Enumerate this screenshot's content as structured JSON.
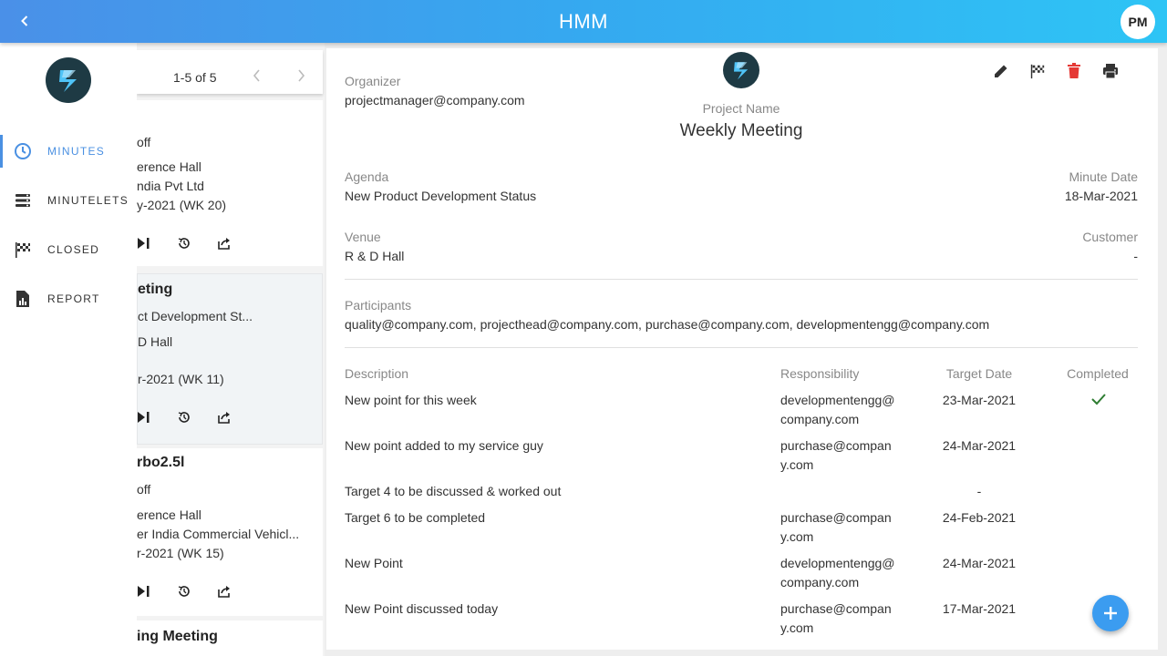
{
  "app": {
    "title": "HMM",
    "avatar_initials": "PM"
  },
  "sidebar": {
    "items": [
      {
        "label": "MINUTES",
        "icon": "clock-icon",
        "active": true
      },
      {
        "label": "MINUTELETS",
        "icon": "list-icon",
        "active": false
      },
      {
        "label": "CLOSED",
        "icon": "checkered-flag-icon",
        "active": false
      },
      {
        "label": "REPORT",
        "icon": "report-icon",
        "active": false
      }
    ]
  },
  "list": {
    "pagination": "1-5 of 5",
    "cards": [
      {
        "title": "",
        "lines": [
          "off",
          "erence Hall",
          "ndia Pvt Ltd",
          "y-2021 (WK 20)"
        ]
      },
      {
        "title": "eting",
        "lines": [
          "ct Development St...",
          "D Hall",
          "r-2021 (WK 11)"
        ]
      },
      {
        "title": "rbo2.5l",
        "lines": [
          "off",
          "erence Hall",
          "er India Commercial Vehicl...",
          "r-2021 (WK 15)"
        ]
      },
      {
        "title": "ing Meeting",
        "lines": []
      }
    ]
  },
  "detail": {
    "organizer_label": "Organizer",
    "organizer": "projectmanager@company.com",
    "project_name_label": "Project Name",
    "project_name": "Weekly Meeting",
    "agenda_label": "Agenda",
    "agenda": "New Product Development Status",
    "minute_date_label": "Minute Date",
    "minute_date": "18-Mar-2021",
    "venue_label": "Venue",
    "venue": "R & D Hall",
    "customer_label": "Customer",
    "customer": "-",
    "participants_label": "Participants",
    "participants": "quality@company.com, projecthead@company.com, purchase@company.com, developmentengg@company.com",
    "table": {
      "headers": {
        "description": "Description",
        "responsibility": "Responsibility",
        "target_date": "Target Date",
        "completed": "Completed"
      },
      "rows": [
        {
          "description": "New point for this week",
          "resp1": "developmentengg@",
          "resp2": "company.com",
          "target": "23-Mar-2021",
          "completed": true
        },
        {
          "description": "New point added to my service guy",
          "resp1": "purchase@compan",
          "resp2": "y.com",
          "target": "24-Mar-2021",
          "completed": false
        },
        {
          "description": "Target 4 to be discussed & worked out",
          "resp1": "",
          "resp2": "",
          "target": "-",
          "completed": false
        },
        {
          "description": "Target 6 to be completed",
          "resp1": "purchase@compan",
          "resp2": "y.com",
          "target": "24-Feb-2021",
          "completed": false
        },
        {
          "description": "New Point",
          "resp1": "developmentengg@",
          "resp2": "company.com",
          "target": "24-Mar-2021",
          "completed": false
        },
        {
          "description": "New Point discussed today",
          "resp1": "purchase@compan",
          "resp2": "y.com",
          "target": "17-Mar-2021",
          "completed": false
        }
      ]
    }
  },
  "colors": {
    "accent": "#4a90e2",
    "delete": "#e53935",
    "check": "#2e7d32",
    "fab": "#3b9cf0"
  }
}
